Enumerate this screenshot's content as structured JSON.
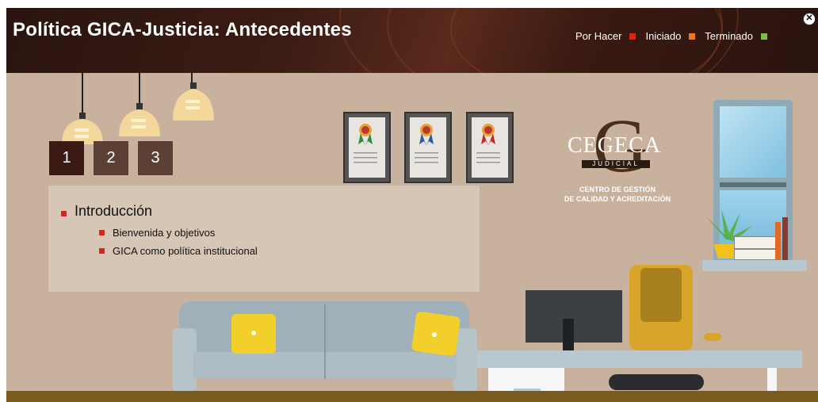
{
  "header": {
    "title": "Política GICA-Justicia: Antecedentes",
    "legend": [
      {
        "label": "Por Hacer",
        "color": "#e0201a"
      },
      {
        "label": "Iniciado",
        "color": "#f07a1a"
      },
      {
        "label": "Terminado",
        "color": "#7ac142"
      }
    ],
    "close_icon": "close-icon"
  },
  "nav": {
    "buttons": [
      {
        "label": "1",
        "color": "#3a1a12"
      },
      {
        "label": "2",
        "color": "#5c4036"
      },
      {
        "label": "3",
        "color": "#5c4036"
      }
    ]
  },
  "content": {
    "section_title": "Introducción",
    "items": [
      "Bienvenida y objetivos",
      "GICA como política institucional"
    ]
  },
  "logo": {
    "letter": "G",
    "name": "CEGECA",
    "tag": "JUDICIAL",
    "line1": "CENTRO DE GESTIÓN",
    "line2": "DE CALIDAD Y ACREDITACIÓN"
  }
}
